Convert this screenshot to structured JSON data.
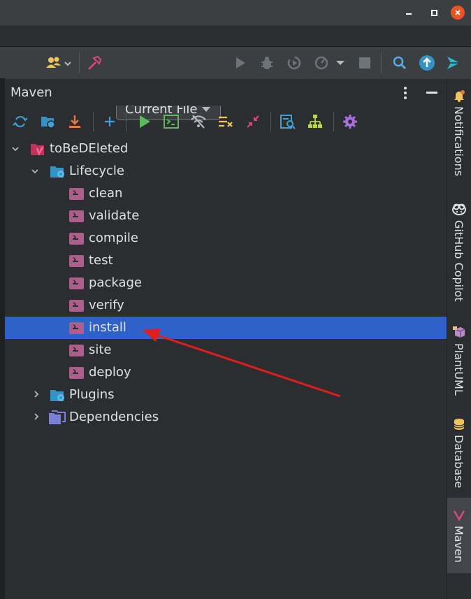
{
  "toolbar": {
    "run_config": "Current File"
  },
  "maven": {
    "title": "Maven",
    "project": "toBeDEleted",
    "lifecycle": {
      "label": "Lifecycle",
      "goals": [
        "clean",
        "validate",
        "compile",
        "test",
        "package",
        "verify",
        "install",
        "site",
        "deploy"
      ],
      "selected": "install"
    },
    "plugins": "Plugins",
    "dependencies": "Dependencies"
  },
  "right_stripe": {
    "notifications": "Notifications",
    "copilot": "GitHub Copilot",
    "plantuml": "PlantUML",
    "database": "Database",
    "maven": "Maven"
  },
  "colors": {
    "selection": "#2e62c9",
    "arrow": "#e11d1d",
    "maven_brand": "#d9365e"
  }
}
